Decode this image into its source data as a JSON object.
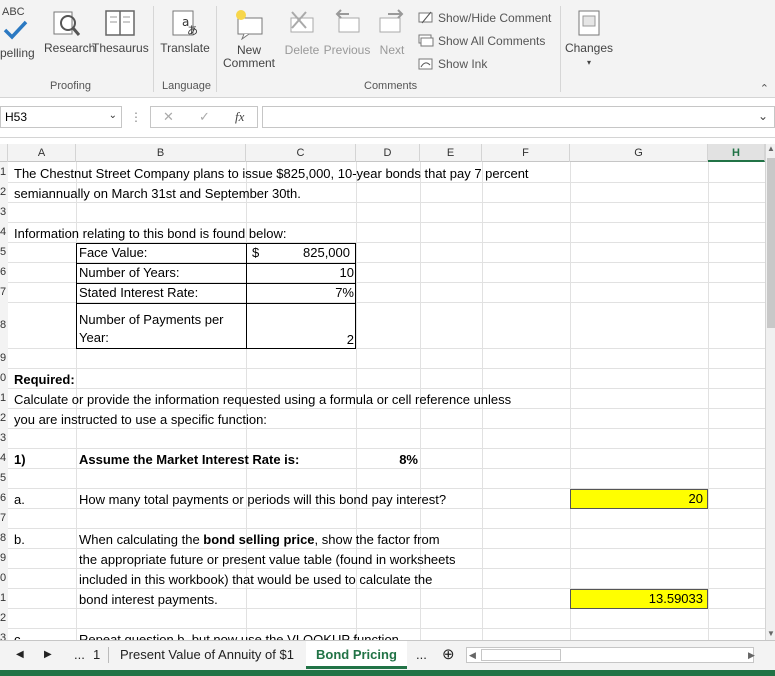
{
  "ribbon": {
    "abc": "ABC",
    "spelling": "pelling",
    "research": "Research",
    "thesaurus": "Thesaurus",
    "translate": "Translate",
    "new_comment_1": "New",
    "new_comment_2": "Comment",
    "delete": "Delete",
    "previous": "Previous",
    "next": "Next",
    "show_hide": "Show/Hide Comment",
    "show_all": "Show All Comments",
    "show_ink": "Show Ink",
    "changes": "Changes",
    "group_proofing": "Proofing",
    "group_language": "Language",
    "group_comments": "Comments"
  },
  "formula_bar": {
    "name_box": "H53",
    "fx": "fx",
    "cancel": "✕",
    "enter": "✓"
  },
  "columns": [
    "A",
    "B",
    "C",
    "D",
    "E",
    "F",
    "G",
    "H"
  ],
  "rows": [
    "1",
    "2",
    "3",
    "4",
    "5",
    "6",
    "7",
    "8",
    "9",
    "0",
    "1",
    "2",
    "3",
    "4",
    "5",
    "6",
    "7",
    "8",
    "9",
    "0",
    "1",
    "2",
    "3"
  ],
  "sheet": {
    "line1": "The Chestnut Street Company plans to issue $825,000, 10-year bonds that pay 7 percent",
    "line2": "semiannually on March 31st and September 30th.",
    "info": "Information relating to this bond is found below:",
    "face_label": "Face Value:",
    "face_sign": "$",
    "face_value": "825,000",
    "years_label": "Number of Years:",
    "years_value": "10",
    "rate_label": "Stated Interest Rate:",
    "rate_value": "7%",
    "payments_label_1": "Number of Payments per",
    "payments_label_2": "Year:",
    "payments_value": "2",
    "required": "Required:",
    "req_line1": "Calculate or provide the information requested using a formula or cell reference unless",
    "req_line2": "you are instructed to use a specific function:",
    "q1": "1)",
    "market_label": "Assume the Market Interest Rate is:",
    "market_value": "8%",
    "qa": "a.",
    "qa_text": "How many total payments or periods will this bond pay interest?",
    "qa_answer": "20",
    "qb": "b.",
    "qb_line1_pre": "When calculating the ",
    "qb_line1_bold": "bond selling price",
    "qb_line1_post": ", show the factor from",
    "qb_line2": "the appropriate future or present value table (found in worksheets",
    "qb_line3": "included in this workbook) that would be used to calculate the",
    "qb_line4": "bond interest payments.",
    "qb_answer": "13.59033",
    "qc": "c.",
    "qc_text": "Repeat question b. but now use the VLOOKUP function"
  },
  "tabs": {
    "ellipsis_left": "...",
    "num": "1",
    "tab1": "Present Value of Annuity of $1",
    "tab2": "Bond Pricing",
    "ellipsis_right": "..."
  },
  "colors": {
    "highlight": "#ffff00",
    "excel_green": "#217346"
  }
}
